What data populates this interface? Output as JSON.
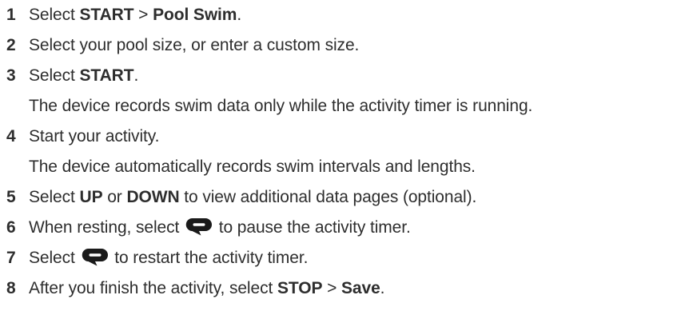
{
  "steps": [
    {
      "num": "1",
      "parts": [
        "Select ",
        "START",
        " > ",
        "Pool Swim",
        "."
      ]
    },
    {
      "num": "2",
      "parts": [
        "Select your pool size, or enter a custom size."
      ]
    },
    {
      "num": "3",
      "parts": [
        "Select ",
        "START",
        "."
      ]
    },
    {
      "note": "The device records swim data only while the activity timer is running."
    },
    {
      "num": "4",
      "parts": [
        "Start your activity."
      ]
    },
    {
      "note": "The device automatically records swim intervals and lengths."
    },
    {
      "num": "5",
      "parts": [
        "Select ",
        "UP",
        " or ",
        "DOWN",
        " to view additional data pages (optional)."
      ]
    },
    {
      "num": "6",
      "parts": [
        "When resting, select ",
        " to pause the activity timer."
      ],
      "icon": "lap-loop-icon"
    },
    {
      "num": "7",
      "parts": [
        "Select ",
        " to restart the activity timer."
      ],
      "icon": "lap-loop-icon"
    },
    {
      "num": "8",
      "parts": [
        "After you finish the activity, select ",
        "STOP",
        " > ",
        "Save",
        "."
      ]
    }
  ]
}
